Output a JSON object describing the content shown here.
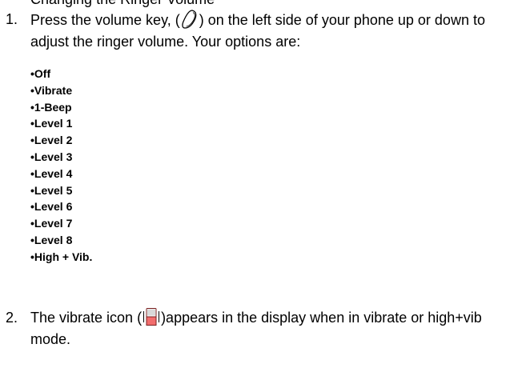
{
  "header_fragment": "Changing the Ringer Volume",
  "steps": [
    {
      "number": "1.",
      "text_before_icon": "Press the volume key, (",
      "icon": "volume-key-icon",
      "text_after_icon": ") on the left side of your phone up or down to adjust the ringer volume. Your options are:"
    },
    {
      "number": "2.",
      "text_before_icon": "The vibrate icon (",
      "icon": "vibrate-icon",
      "text_after_icon": ")appears in the display when in vibrate or high+vib mode."
    }
  ],
  "options": [
    "•Off",
    "•Vibrate",
    "•1-Beep",
    "•Level 1",
    "•Level 2",
    "•Level 3",
    "•Level 4",
    "•Level 5",
    "•Level 6",
    "•Level 7",
    "•Level 8",
    "•High + Vib."
  ],
  "colors": {
    "text": "#000000",
    "vibrate_icon_fill": "#f26d6d",
    "vibrate_icon_border": "#7a1f1f"
  }
}
